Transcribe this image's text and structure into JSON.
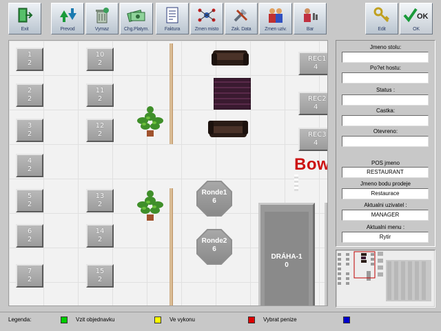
{
  "toolbar": {
    "buttons": [
      {
        "label": "Exit"
      },
      {
        "label": "Prevod"
      },
      {
        "label": "Vymaz"
      },
      {
        "label": "Chg.Platym."
      },
      {
        "label": "Faktura"
      },
      {
        "label": "Zmen misto"
      },
      {
        "label": "Zak. Data"
      },
      {
        "label": "Zmen uziv."
      },
      {
        "label": "Bar"
      },
      {
        "label": "Edit"
      },
      {
        "label": "OK"
      }
    ],
    "ok_glyph_text": "OK"
  },
  "tables": [
    {
      "name": "1",
      "seats": "2"
    },
    {
      "name": "2",
      "seats": "2"
    },
    {
      "name": "3",
      "seats": "2"
    },
    {
      "name": "4",
      "seats": "2"
    },
    {
      "name": "5",
      "seats": "2"
    },
    {
      "name": "6",
      "seats": "2"
    },
    {
      "name": "7",
      "seats": "2"
    },
    {
      "name": "10",
      "seats": "2"
    },
    {
      "name": "11",
      "seats": "2"
    },
    {
      "name": "12",
      "seats": "2"
    },
    {
      "name": "13",
      "seats": "2"
    },
    {
      "name": "14",
      "seats": "2"
    },
    {
      "name": "15",
      "seats": "2"
    },
    {
      "name": "REC1",
      "seats": "4"
    },
    {
      "name": "REC2",
      "seats": "4"
    },
    {
      "name": "REC3",
      "seats": "4"
    }
  ],
  "round_tables": [
    {
      "name": "Ronde1",
      "seats": "6"
    },
    {
      "name": "Ronde2",
      "seats": "6"
    }
  ],
  "lane": {
    "name": "DRÁHA-1",
    "seats": "0"
  },
  "bowling_sign": "Bow",
  "panel": {
    "jmeno_stolu": {
      "label": "Jmeno stolu:",
      "value": ""
    },
    "pocet_hostu": {
      "label": "Po?et hostu:",
      "value": ""
    },
    "status": {
      "label": "Status :",
      "value": ""
    },
    "castka": {
      "label": "Castka:",
      "value": ""
    },
    "otevreno": {
      "label": "Otevreno:",
      "value": ""
    },
    "pos_jmeno": {
      "label": "POS jmeno",
      "value": "RESTAURANT"
    },
    "bod_prodeje": {
      "label": "Jmeno bodu prodeje",
      "value": "Restaurace"
    },
    "uzivatel": {
      "label": "Aktualni uzivatel :",
      "value": "MANAGER"
    },
    "menu": {
      "label": "Aktualni menu :",
      "value": "Rytir"
    }
  },
  "legend": {
    "title": "Legenda:",
    "items": [
      {
        "color": "#00cc00",
        "text": "Vzit objednavku"
      },
      {
        "color": "#ffff00",
        "text": "Ve vykonu"
      },
      {
        "color": "#dd0000",
        "text": "Vybrat penize"
      },
      {
        "color": "#0000cc",
        "text": ""
      }
    ]
  },
  "colors": {
    "bowling_sign": "#cc1111"
  }
}
